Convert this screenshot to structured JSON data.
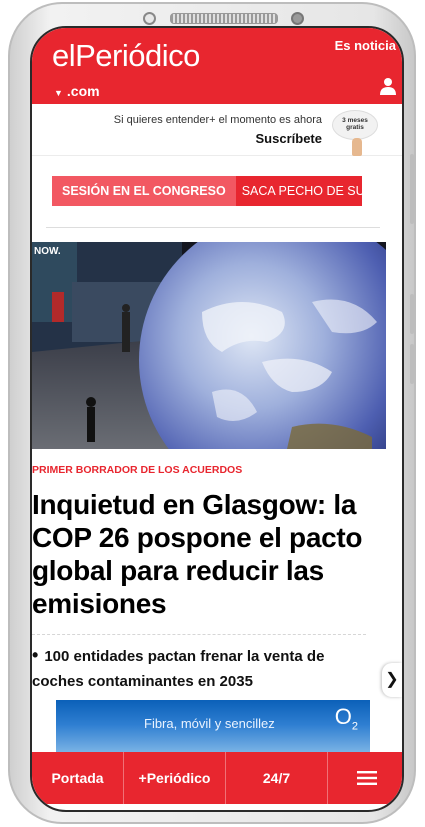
{
  "header": {
    "logo": "elPeriódico",
    "domain": ".com",
    "es_noticia": "Es noticia"
  },
  "subscribe": {
    "line1": "Si quieres entender+ el momento es ahora",
    "cta": "Suscríbete",
    "promo": "3 meses gratis"
  },
  "topics": [
    "SESIÓN EN EL CONGRESO",
    "SACA PECHO DE SU"
  ],
  "article": {
    "kicker": "PRIMER BORRADOR DE LOS ACUERDOS",
    "headline": "Inquietud en Glasgow: la COP 26 pospone el pacto global para reducir las emisiones",
    "related": "100 entidades pactan frenar la venta de coches contaminantes en 2035"
  },
  "ad": {
    "text": "Fibra, móvil y sencillez",
    "brand": "O",
    "brand_sub": "2"
  },
  "bottom_nav": {
    "items": [
      "Portada",
      "+Periódico",
      "24/7"
    ]
  },
  "colors": {
    "brand_red": "#e8262f",
    "topic_pink": "#f25862"
  }
}
